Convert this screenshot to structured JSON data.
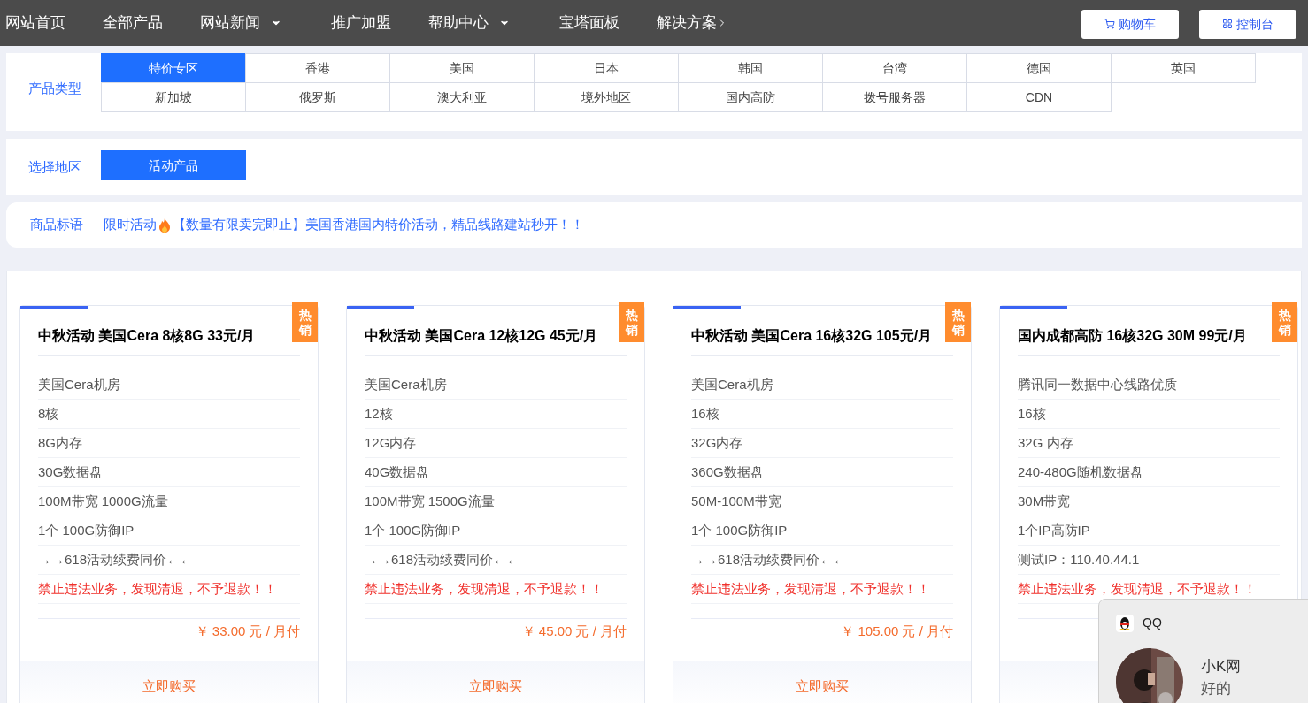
{
  "nav": {
    "items": [
      {
        "label": "网站首页",
        "dropdown": false,
        "chevron": false
      },
      {
        "label": "全部产品",
        "dropdown": false,
        "chevron": false
      },
      {
        "label": "网站新闻",
        "dropdown": true,
        "chevron": false
      },
      {
        "label": "推广加盟",
        "dropdown": false,
        "chevron": false
      },
      {
        "label": "帮助中心",
        "dropdown": true,
        "chevron": false
      },
      {
        "label": "宝塔面板",
        "dropdown": false,
        "chevron": false
      },
      {
        "label": "解决方案",
        "dropdown": false,
        "chevron": true
      }
    ],
    "buttons": [
      {
        "label": "购物车",
        "kind": "cart"
      },
      {
        "label": "控制台",
        "kind": "console"
      }
    ]
  },
  "product_type": {
    "label": "产品类型",
    "options": [
      {
        "label": "特价专区",
        "selected": true
      },
      {
        "label": "香港",
        "selected": false
      },
      {
        "label": "美国",
        "selected": false
      },
      {
        "label": "日本",
        "selected": false
      },
      {
        "label": "韩国",
        "selected": false
      },
      {
        "label": "台湾",
        "selected": false
      },
      {
        "label": "德国",
        "selected": false
      },
      {
        "label": "英国",
        "selected": false
      },
      {
        "label": "新加坡",
        "selected": false
      },
      {
        "label": "俄罗斯",
        "selected": false
      },
      {
        "label": "澳大利亚",
        "selected": false
      },
      {
        "label": "境外地区",
        "selected": false
      },
      {
        "label": "国内高防",
        "selected": false
      },
      {
        "label": "拨号服务器",
        "selected": false
      },
      {
        "label": "CDN",
        "selected": false
      }
    ]
  },
  "region": {
    "label": "选择地区",
    "options": [
      {
        "label": "活动产品",
        "selected": true
      }
    ]
  },
  "slogan": {
    "label": "商品标语",
    "prefix": "限时活动",
    "text": "【数量有限卖完即止】美国香港国内特价活动，精品线路建站秒开！！"
  },
  "products": [
    {
      "title": "中秋活动 美国Cera 8核8G 33元/月",
      "badge": "热销",
      "specs": [
        "美国Cera机房",
        "8核",
        "8G内存",
        "30G数据盘",
        "100M带宽 1000G流量",
        "1个 100G防御IP",
        "→→618活动续费同价←←"
      ],
      "warning": "禁止违法业务，发现清退，不予退款！！",
      "price": "￥ 33.00 元 / 月付",
      "buy": "立即购买"
    },
    {
      "title": "中秋活动 美国Cera 12核12G 45元/月",
      "badge": "热销",
      "specs": [
        "美国Cera机房",
        "12核",
        "12G内存",
        "40G数据盘",
        "100M带宽 1500G流量",
        "1个 100G防御IP",
        "→→618活动续费同价←←"
      ],
      "warning": "禁止违法业务，发现清退，不予退款！！",
      "price": "￥ 45.00 元 / 月付",
      "buy": "立即购买"
    },
    {
      "title": "中秋活动 美国Cera 16核32G 105元/月",
      "badge": "热销",
      "specs": [
        "美国Cera机房",
        "16核",
        "32G内存",
        "360G数据盘",
        "50M-100M带宽",
        "1个 100G防御IP",
        "→→618活动续费同价←←"
      ],
      "warning": "禁止违法业务，发现清退，不予退款！！",
      "price": "￥ 105.00 元 / 月付",
      "buy": "立即购买"
    },
    {
      "title": "国内成都高防 16核32G 30M 99元/月",
      "badge": "热销",
      "specs": [
        "腾讯同一数据中心线路优质",
        "16核",
        "32G 内存",
        "240-480G随机数据盘",
        "30M带宽",
        "1个IP高防IP",
        "测试IP：110.40.44.1"
      ],
      "warning": "禁止违法业务，发现清退，不予退款！！"
    }
  ],
  "notification": {
    "app": "QQ",
    "sender": "小K网",
    "message": "好的"
  }
}
